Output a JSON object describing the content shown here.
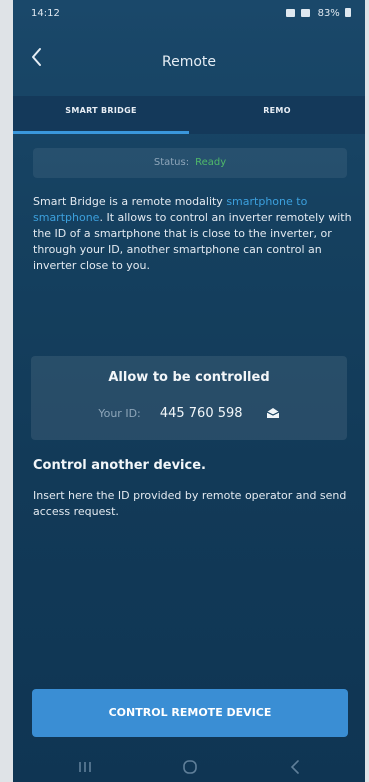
{
  "status_bar": {
    "time": "14:12",
    "battery": "83%"
  },
  "header": {
    "title": "Remote"
  },
  "tabs": [
    {
      "label": "SMART BRIDGE",
      "active": true
    },
    {
      "label": "REMO",
      "active": false
    }
  ],
  "status": {
    "label": "Status:",
    "value": "Ready"
  },
  "description": {
    "before": "Smart Bridge is a remote modality ",
    "link": "smartphone to smartphone",
    "after": ". It allows to control an inverter remotely with the ID of a smartphone that is close to the inverter, or through your ID, another smartphone can control an inverter close to you."
  },
  "allow": {
    "title": "Allow to be controlled",
    "id_label": "Your ID:",
    "id_value": "445 760 598"
  },
  "control": {
    "title": "Control another device.",
    "text": "Insert here the ID provided by remote operator and send access request."
  },
  "cta": {
    "label": "CONTROL REMOTE DEVICE"
  },
  "colors": {
    "accent": "#3a97dc",
    "ready": "#4fb96a",
    "button": "#3a8ed4"
  },
  "icons": {
    "back": "chevron-left-icon",
    "share": "share-icon"
  }
}
